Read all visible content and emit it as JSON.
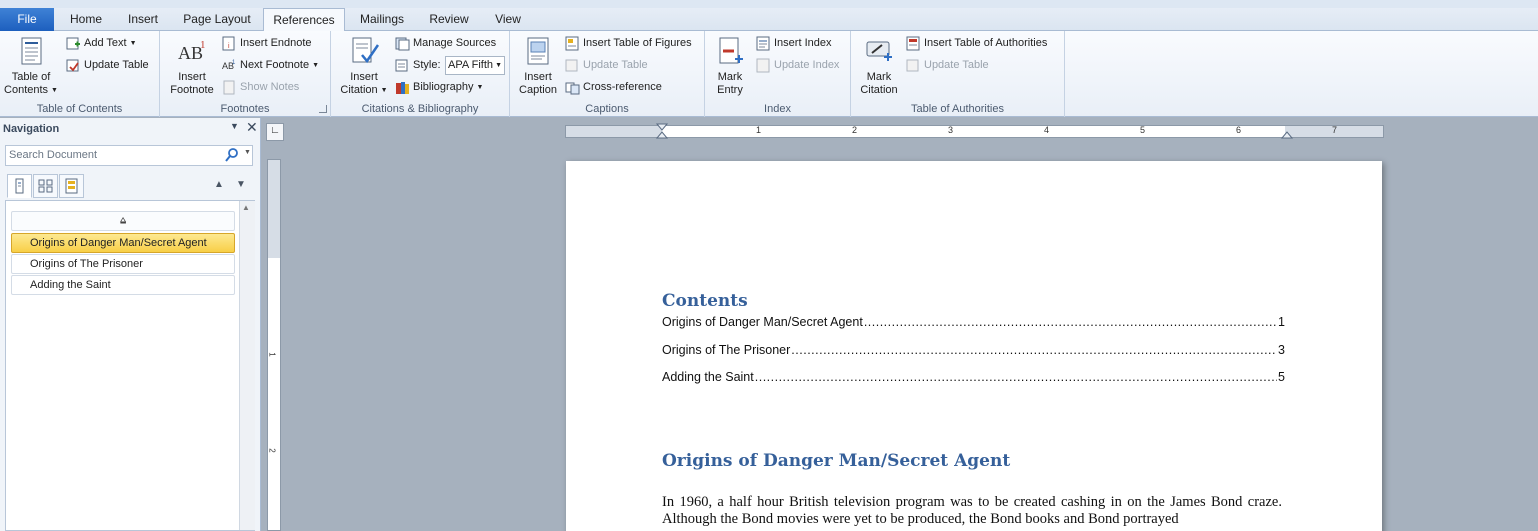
{
  "tabs": [
    {
      "label": "File"
    },
    {
      "label": "Home"
    },
    {
      "label": "Insert"
    },
    {
      "label": "Page Layout"
    },
    {
      "label": "References"
    },
    {
      "label": "Mailings"
    },
    {
      "label": "Review"
    },
    {
      "label": "View"
    }
  ],
  "active_tab": "References",
  "ribbon": {
    "toc_group": {
      "label": "Table of Contents",
      "table_of_contents": {
        "line1": "Table of",
        "line2": "Contents"
      },
      "add_text": "Add Text",
      "update_table": "Update Table"
    },
    "footnotes_group": {
      "label": "Footnotes",
      "insert_footnote": {
        "line1": "Insert",
        "line2": "Footnote"
      },
      "insert_endnote": "Insert Endnote",
      "next_footnote": "Next Footnote",
      "show_notes": "Show Notes"
    },
    "citations_group": {
      "label": "Citations & Bibliography",
      "insert_citation": {
        "line1": "Insert",
        "line2": "Citation"
      },
      "manage_sources": "Manage Sources",
      "style_label": "Style:",
      "style_value": "APA Fifth",
      "bibliography": "Bibliography"
    },
    "captions_group": {
      "label": "Captions",
      "insert_caption": {
        "line1": "Insert",
        "line2": "Caption"
      },
      "insert_table_of_figures": "Insert Table of Figures",
      "update_table": "Update Table",
      "cross_reference": "Cross-reference"
    },
    "index_group": {
      "label": "Index",
      "mark_entry": {
        "line1": "Mark",
        "line2": "Entry"
      },
      "insert_index": "Insert Index",
      "update_index": "Update Index"
    },
    "authorities_group": {
      "label": "Table of Authorities",
      "mark_citation": {
        "line1": "Mark",
        "line2": "Citation"
      },
      "insert_table_of_authorities": "Insert Table of Authorities",
      "update_table": "Update Table"
    }
  },
  "navigation": {
    "title": "Navigation",
    "search_placeholder": "Search Document",
    "items": [
      {
        "label": "Origins of Danger Man/Secret Agent",
        "selected": true
      },
      {
        "label": "Origins of The Prisoner",
        "selected": false
      },
      {
        "label": "Adding the Saint",
        "selected": false
      }
    ]
  },
  "ruler": {
    "numbers": [
      "1",
      "2",
      "3",
      "4",
      "5",
      "6",
      "7"
    ],
    "vertical_numbers": [
      "1",
      "2"
    ]
  },
  "document": {
    "toc_heading": "Contents",
    "toc_entries": [
      {
        "title": "Origins of Danger Man/Secret Agent",
        "page": "1"
      },
      {
        "title": "Origins of The Prisoner",
        "page": "3"
      },
      {
        "title": "Adding the Saint",
        "page": "5"
      }
    ],
    "section_heading": "Origins of Danger Man/Secret Agent",
    "body_text": "In 1960, a half hour British television program was to be created cashing in on the James Bond craze. Although the Bond movies were yet to be produced, the Bond books and Bond portrayed"
  },
  "colors": {
    "heading": "#36609a",
    "file_tab": "#1d5fbe",
    "selected_item": "#f8cf47"
  }
}
